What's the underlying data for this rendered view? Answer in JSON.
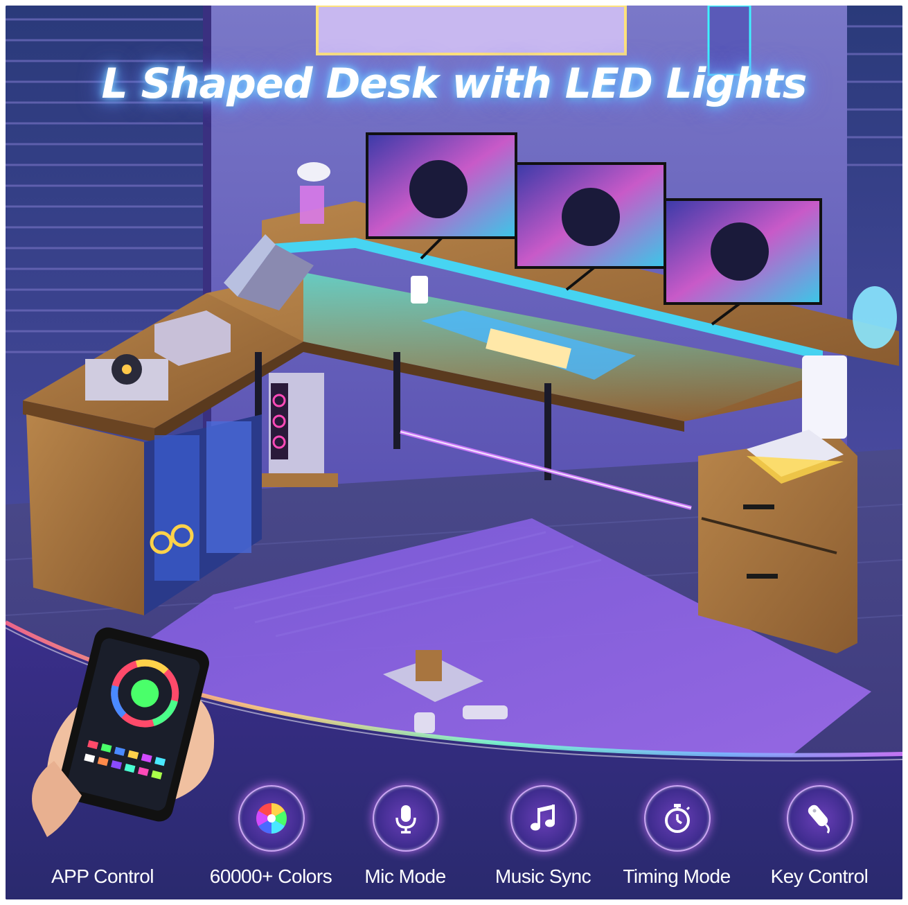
{
  "title": "L Shaped Desk with LED Lights",
  "features": [
    {
      "label": "APP Control",
      "icon": "color-wheel-icon"
    },
    {
      "label": "60000+ Colors",
      "icon": "color-wheel-icon"
    },
    {
      "label": "Mic Mode",
      "icon": "microphone-icon"
    },
    {
      "label": "Music Sync",
      "icon": "music-note-icon"
    },
    {
      "label": "Timing Mode",
      "icon": "timer-icon"
    },
    {
      "label": "Key Control",
      "icon": "remote-key-icon"
    }
  ],
  "colors": {
    "led_cyan": "#2ee6ff",
    "led_purple": "#b36bff",
    "wood": "#a8753f",
    "background": "#4a3fa0"
  }
}
